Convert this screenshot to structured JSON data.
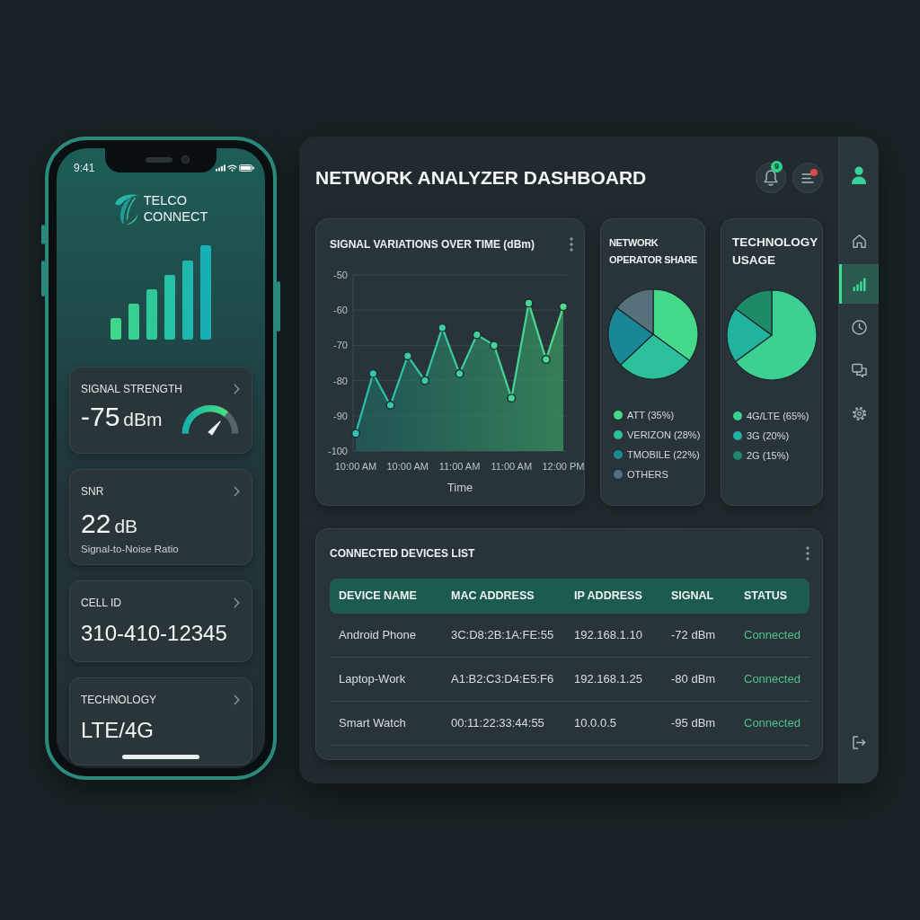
{
  "phone": {
    "status_bar": {
      "time": "9:41"
    },
    "app_name": "TELCO CONNECT",
    "cards": [
      {
        "kind": "gauge",
        "label": "SIGNAL STRENGTH",
        "value": "-75",
        "unit": "dBm",
        "level": 0.72
      },
      {
        "kind": "metric",
        "label": "SNR",
        "value": "22",
        "unit": "dB",
        "caption": "Signal-to-Noise Ratio"
      },
      {
        "kind": "plain",
        "label": "CELL ID",
        "value": "310-410-12345"
      },
      {
        "kind": "plain",
        "label": "TECHNOLOGY",
        "value": "LTE/4G"
      }
    ]
  },
  "dashboard": {
    "title": "NETWORK ANALYZER DASHBOARD",
    "notifications": {
      "count": "9"
    },
    "menu": {
      "alert": true
    },
    "signal_chart": {
      "shaded": true,
      "chart_data": {
        "type": "line",
        "title": "SIGNAL VARIATIONS OVER TIME (dBm)",
        "xlabel": "Time",
        "categories": [
          "10:00 AM",
          null,
          null,
          "10:00 AM",
          null,
          null,
          "11:00 AM",
          null,
          null,
          "11:00 AM",
          null,
          null,
          "12:00 PM"
        ],
        "values": [
          -95,
          -78,
          -87,
          -73,
          -80,
          -65,
          -78,
          -67,
          -70,
          -85,
          -58,
          -74,
          -59
        ],
        "ylim": [
          -100,
          -50
        ],
        "yticks": [
          -100,
          -90,
          -80,
          -70,
          -60,
          -50
        ],
        "grid": true,
        "marker": "circle"
      }
    },
    "operator_share": {
      "chart_data": {
        "type": "pie",
        "title": "NETWORK OPERATOR SHARE",
        "categories": [
          "ATT (35%)",
          "VERIZON (28%)",
          "TMOBILE (22%)",
          "OTHERS"
        ],
        "values": [
          35,
          28,
          22,
          15
        ],
        "colors": [
          "#45d98b",
          "#2bbf9a",
          "#1a8796",
          "#56707c"
        ]
      }
    },
    "technology_usage": {
      "chart_data": {
        "type": "pie",
        "title": "TECHNOLOGY USAGE",
        "categories": [
          "4G/LTE (65%)",
          "3G (20%)",
          "2G (15%)"
        ],
        "values": [
          65,
          20,
          15
        ],
        "colors": [
          "#3cd092",
          "#22b3a0",
          "#1e8a68"
        ]
      }
    },
    "devices": {
      "title": "CONNECTED DEVICES LIST",
      "columns": [
        "DEVICE NAME",
        "MAC ADDRESS",
        "IP ADDRESS",
        "SIGNAL",
        "STATUS"
      ],
      "rows": [
        {
          "cells": [
            "Android Phone",
            "3C:D8:2B:1A:FE:55",
            "192.168.1.10",
            "-72 dBm",
            "Connected"
          ],
          "connected": true
        },
        {
          "cells": [
            "Laptop-Work",
            "A1:B2:C3:D4:E5:F6",
            "192.168.1.25",
            "-80 dBm",
            "Connected"
          ],
          "connected": true
        },
        {
          "cells": [
            "Smart Watch",
            "00:11:22:33:44:55",
            "10.0.0.5",
            "-95 dBm",
            "Connected"
          ],
          "connected": true
        }
      ]
    },
    "sidebar": {
      "items": [
        {
          "selected": false
        },
        {
          "selected": true
        },
        {
          "selected": false
        },
        {
          "selected": false
        },
        {
          "selected": false
        }
      ]
    }
  }
}
